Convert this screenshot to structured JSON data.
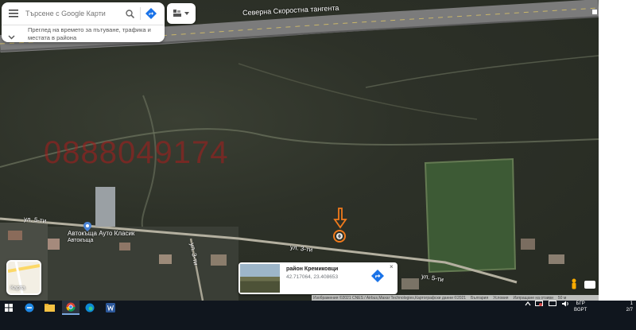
{
  "search": {
    "placeholder": "Търсене с Google Карти",
    "panel_text": "Преглед на времето за пътуване, трафика и местата в района"
  },
  "icons": {
    "menu": "menu-icon",
    "search": "search-icon",
    "directions": "directions-icon",
    "layers": "layers-icon",
    "dropdown": "chevron-down-icon",
    "expand": "chevron-down-icon"
  },
  "map": {
    "watermark": "0888049174",
    "roads": {
      "highway": "Северна Скоростна тангента",
      "street_left": "ул. 5-ти",
      "street_mid": "ул. 3-ти",
      "street_right": "ул. 3-ти",
      "street_vertical": "ул. 3-ти",
      "street_far_right": "ул. 5-ти"
    },
    "poi": {
      "name": "Автокъща Ауто Класик",
      "subtitle": "Автокъща"
    },
    "pin_colors": {
      "pin": "#e87722",
      "arrow": "#f07a1c"
    }
  },
  "map_type": {
    "label": "Карта"
  },
  "place_card": {
    "title": "район Кремиковци",
    "coords": "42.717064, 23.408653",
    "close": "×"
  },
  "attribution": {
    "imagery": "Изображения ©2021 CNES / Airbus,Maxar Technologies,Картографски данни ©2021",
    "country": "България",
    "terms": "Условия",
    "feedback": "Изпращане на отзиви",
    "scale": "50 м"
  },
  "taskbar": {
    "lang_line1": "БГР",
    "lang_line2": "BGPT",
    "time": "1",
    "date": "2/7"
  }
}
